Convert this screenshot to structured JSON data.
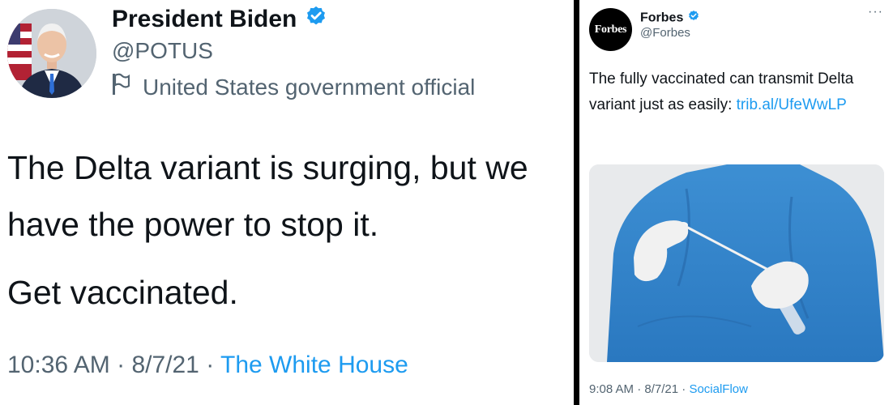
{
  "left_tweet": {
    "author_name": "President Biden",
    "handle": "@POTUS",
    "account_label": "United States government official",
    "text_lines": [
      "The Delta variant is surging, but we have the power to stop it.",
      "Get vaccinated."
    ],
    "time": "10:36 AM",
    "date": "8/7/21",
    "source": "The White House",
    "separator": "·"
  },
  "right_tweet": {
    "author_name": "Forbes",
    "handle": "@Forbes",
    "avatar_text": "Forbes",
    "more": "···",
    "text": "The fully vaccinated can transmit Delta variant just as easily:",
    "link": "trib.al/UfeWwLP",
    "time": "9:08 AM",
    "date": "8/7/21",
    "source": "SocialFlow",
    "separator": "·"
  },
  "colors": {
    "text": "#0f1419",
    "secondary": "#536471",
    "link": "#1d9bf0",
    "verified": "#1d9bf0",
    "divider": "#000000"
  }
}
